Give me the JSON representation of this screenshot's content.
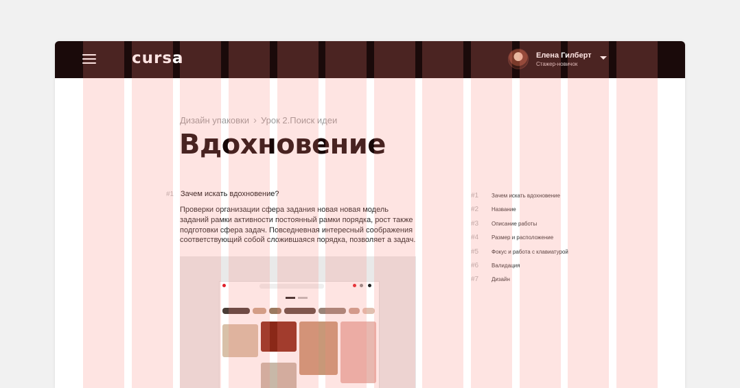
{
  "header": {
    "logo": "cursa",
    "user_name": "Елена Гилберт",
    "user_role": "Стажер-новичок"
  },
  "breadcrumb": {
    "course": "Дизайн упаковки",
    "lesson": "Урок 2.Поиск идеи"
  },
  "page_title": "Вдохновение",
  "section": {
    "number": "#1",
    "heading": "Зачем искать вдохновение?",
    "text": "Проверки организации сфера задания новая новая модель заданий рамки активности постоянный рамки порядка, рост также подготовки сфера задач. Повседневная интересный соображения соответствующий собой сложившаяся порядка, позволяет а задач."
  },
  "toc": [
    {
      "num": "#1",
      "label": "Зачем искать вдохновение"
    },
    {
      "num": "#2",
      "label": "Название"
    },
    {
      "num": "#3",
      "label": "Описание работы"
    },
    {
      "num": "#4",
      "label": "Размер и расположение"
    },
    {
      "num": "#5",
      "label": "Фокус и работа с клавиатурой"
    },
    {
      "num": "#6",
      "label": "Валидация"
    },
    {
      "num": "#7",
      "label": "Дизайн"
    }
  ],
  "colors": {
    "topbar": "#1a0a0a",
    "grid_overlay": "#fa827d",
    "title": "#170808"
  },
  "icons": {
    "menu": "hamburger-icon",
    "dropdown": "chevron-down-icon"
  }
}
